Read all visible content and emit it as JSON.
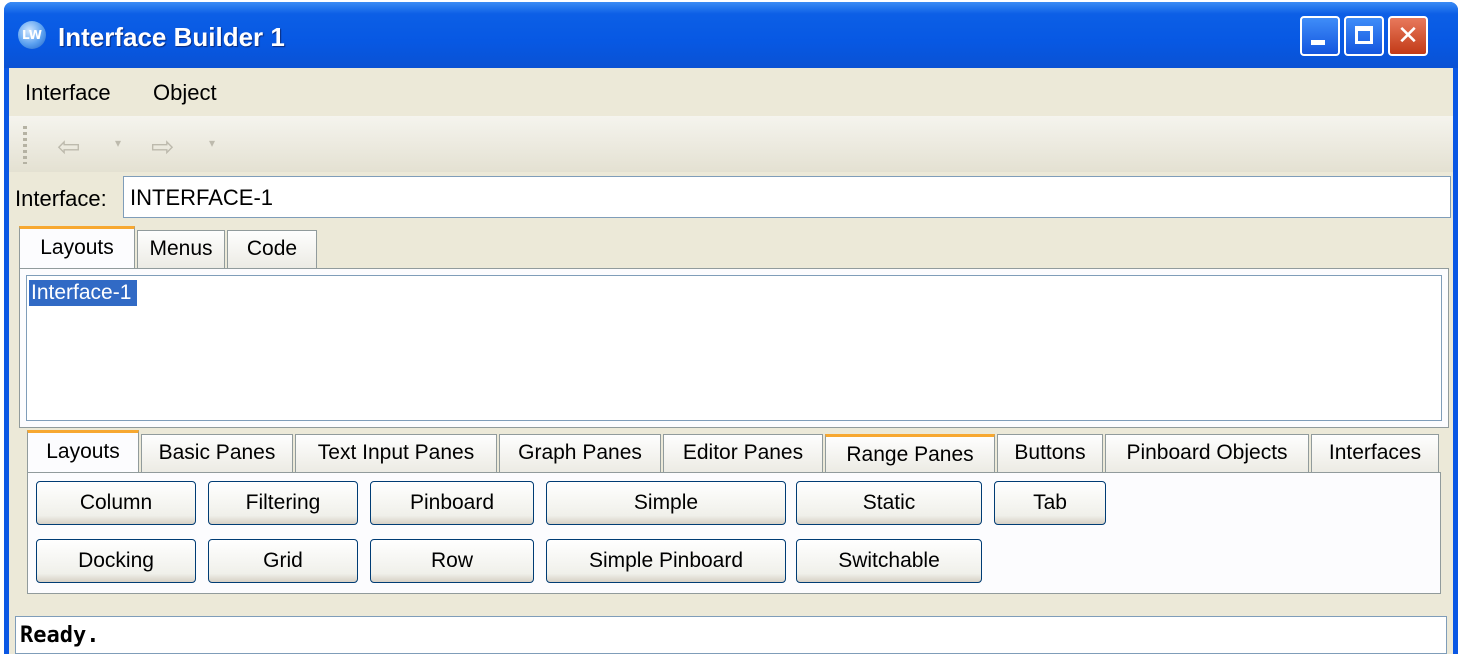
{
  "window": {
    "title": "Interface Builder 1",
    "app_icon": "LW",
    "accent": "#0a57e4"
  },
  "menubar": {
    "items": [
      "Interface",
      "Object"
    ]
  },
  "toolbar": {
    "back_icon": "back-arrow-icon",
    "forward_icon": "forward-arrow-icon",
    "back_glyph": "⇦",
    "forward_glyph": "⇨",
    "drop_glyph": "▾"
  },
  "interface_field": {
    "label": "Interface:",
    "value": "INTERFACE-1"
  },
  "top_tabs": {
    "items": [
      "Layouts",
      "Menus",
      "Code"
    ],
    "selected": "Layouts"
  },
  "layouts_list": {
    "items": [
      "Interface-1"
    ],
    "selected": "Interface-1"
  },
  "palette_tabs": {
    "items": [
      "Layouts",
      "Basic Panes",
      "Text Input Panes",
      "Graph Panes",
      "Editor Panes",
      "Range Panes",
      "Buttons",
      "Pinboard Objects",
      "Interfaces"
    ],
    "selected": "Layouts"
  },
  "layout_buttons": {
    "row1": [
      "Column",
      "Filtering",
      "Pinboard",
      "Simple",
      "Static",
      "Tab"
    ],
    "row2": [
      "Docking",
      "Grid",
      "Row",
      "Simple Pinboard",
      "Switchable"
    ]
  },
  "status": {
    "text": "Ready."
  }
}
